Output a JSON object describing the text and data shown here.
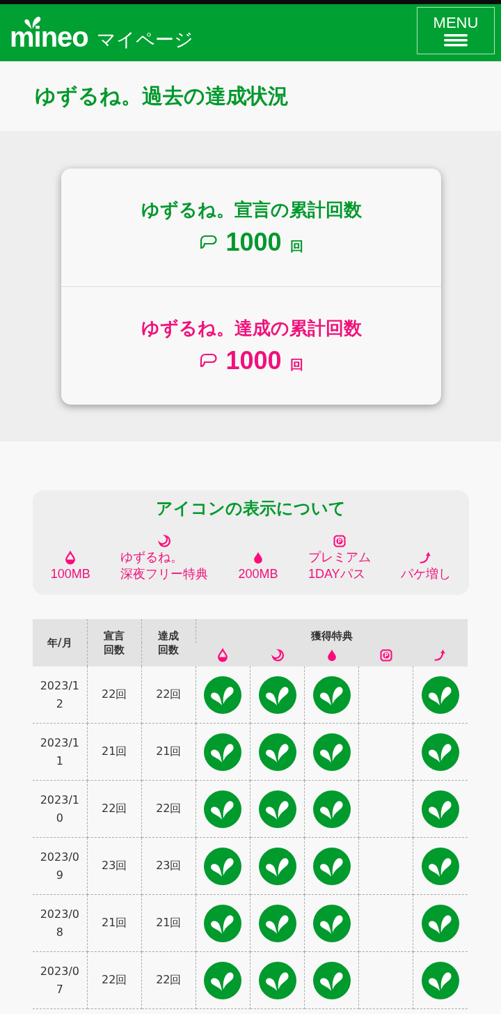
{
  "header": {
    "logo": "mineo",
    "subtitle": "マイページ",
    "menu": "MENU"
  },
  "page_title": "ゆずるね。過去の達成状況",
  "totals": [
    {
      "kind": "declared",
      "title": "ゆずるね。宣言の累計回数",
      "value": "1000",
      "unit": "回"
    },
    {
      "kind": "achieved",
      "title": "ゆずるね。達成の累計回数",
      "value": "1000",
      "unit": "回"
    }
  ],
  "legend": {
    "title": "アイコンの表示について",
    "items": [
      {
        "kind": "drop-outline",
        "label": "100MB"
      },
      {
        "kind": "moon",
        "lines": [
          "ゆずるね。",
          "深夜フリー特典"
        ]
      },
      {
        "kind": "drop",
        "label": "200MB"
      },
      {
        "kind": "premium",
        "lines": [
          "プレミアム",
          "1DAYパス"
        ]
      },
      {
        "kind": "arrow",
        "label": "パケ増し"
      }
    ]
  },
  "table": {
    "columns": [
      "年/月",
      "宣言回数",
      "達成回数"
    ],
    "benefits_header": "獲得特典",
    "benefit_columns": [
      {
        "kind": "drop-outline"
      },
      {
        "kind": "moon"
      },
      {
        "kind": "drop"
      },
      {
        "kind": "premium"
      },
      {
        "kind": "arrow"
      }
    ],
    "rows": [
      {
        "month": "2023/12",
        "declared": "22回",
        "achieved": "22回",
        "earned": [
          true,
          true,
          true,
          false,
          true
        ]
      },
      {
        "month": "2023/11",
        "declared": "21回",
        "achieved": "21回",
        "earned": [
          true,
          true,
          true,
          false,
          true
        ]
      },
      {
        "month": "2023/10",
        "declared": "22回",
        "achieved": "22回",
        "earned": [
          true,
          true,
          true,
          false,
          true
        ]
      },
      {
        "month": "2023/09",
        "declared": "23回",
        "achieved": "23回",
        "earned": [
          true,
          true,
          true,
          false,
          true
        ]
      },
      {
        "month": "2023/08",
        "declared": "21回",
        "achieved": "21回",
        "earned": [
          true,
          true,
          true,
          false,
          true
        ]
      },
      {
        "month": "2023/07",
        "declared": "22回",
        "achieved": "22回",
        "earned": [
          true,
          true,
          true,
          false,
          true
        ]
      }
    ]
  }
}
